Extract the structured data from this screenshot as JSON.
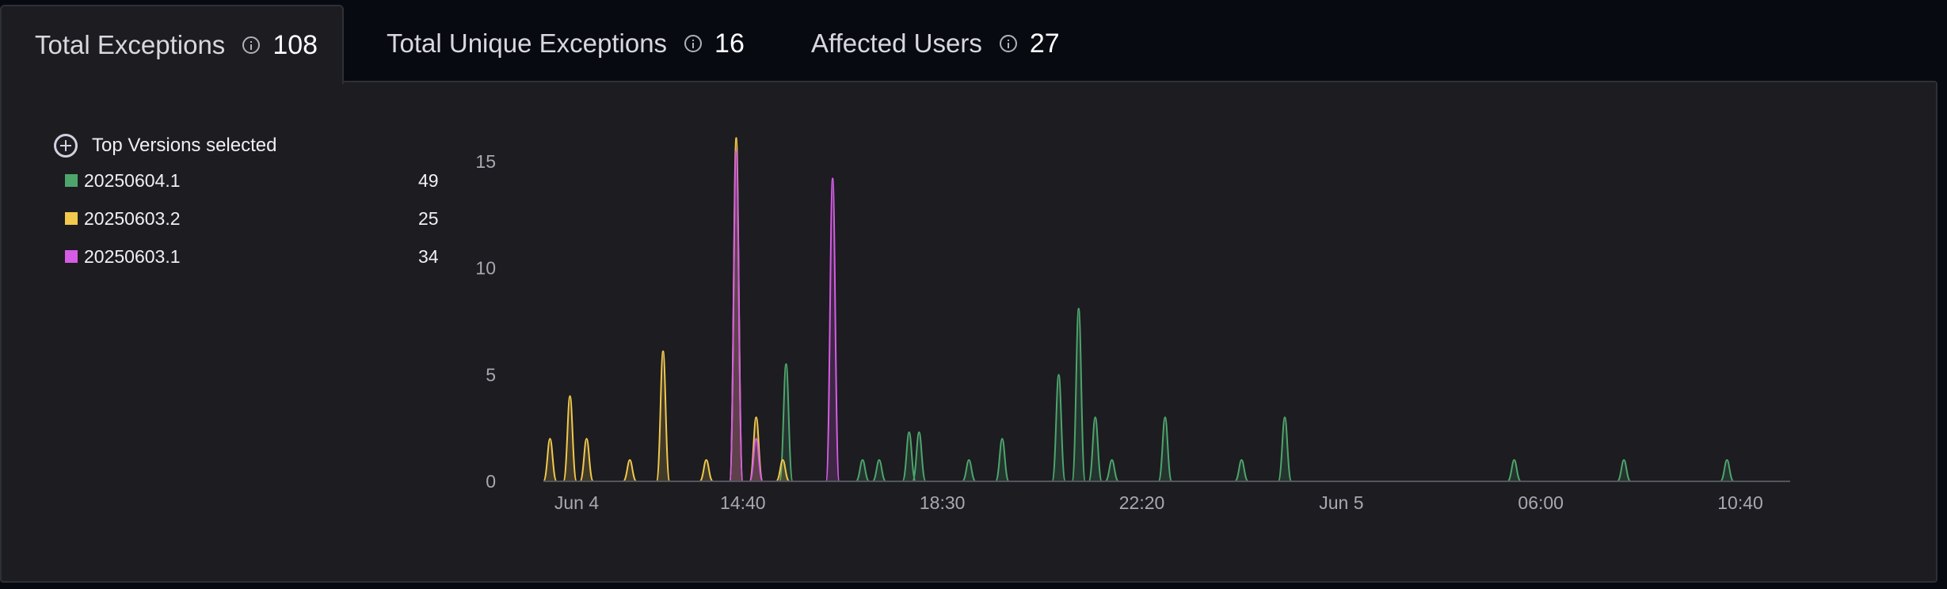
{
  "tabs": [
    {
      "label": "Total Exceptions",
      "value": "108",
      "active": true
    },
    {
      "label": "Total Unique Exceptions",
      "value": "16",
      "active": false
    },
    {
      "label": "Affected Users",
      "value": "27",
      "active": false
    }
  ],
  "legend": {
    "heading": "Top Versions selected",
    "items": [
      {
        "name": "20250604.1",
        "count": "49",
        "color": "#4ea56c"
      },
      {
        "name": "20250603.2",
        "count": "25",
        "color": "#f2c94c"
      },
      {
        "name": "20250603.1",
        "count": "34",
        "color": "#d65ce6"
      }
    ]
  },
  "chart_data": {
    "type": "area",
    "x_unit": "hours after Jun 4 00:00",
    "ylim": [
      0,
      17
    ],
    "xlim": [
      0,
      37.5
    ],
    "yticks": [
      0,
      5,
      10,
      15
    ],
    "ytick_labels": [
      "0",
      "5",
      "10",
      "15"
    ],
    "xticks": [
      0,
      6,
      12,
      18,
      24,
      30,
      36
    ],
    "xtick_labels": [
      "Jun 4",
      "14:40",
      "18:30",
      "22:20",
      "Jun 5",
      "06:00",
      "10:40"
    ],
    "grid": false,
    "series": [
      {
        "name": "20250604.1",
        "color": "#4ea56c",
        "points": [
          [
            7.3,
            5.5
          ],
          [
            9.6,
            1
          ],
          [
            10.1,
            1
          ],
          [
            11.0,
            2.3
          ],
          [
            11.3,
            2.3
          ],
          [
            12.8,
            1
          ],
          [
            13.8,
            2
          ],
          [
            15.5,
            5
          ],
          [
            16.1,
            8.1
          ],
          [
            16.6,
            3
          ],
          [
            17.1,
            1
          ],
          [
            18.7,
            3
          ],
          [
            21.0,
            1
          ],
          [
            22.3,
            3
          ],
          [
            29.2,
            1
          ],
          [
            32.5,
            1
          ],
          [
            35.6,
            1
          ]
        ]
      },
      {
        "name": "20250603.2",
        "color": "#f2c94c",
        "points": [
          [
            0.2,
            2
          ],
          [
            0.8,
            4
          ],
          [
            1.3,
            2
          ],
          [
            2.6,
            1
          ],
          [
            3.6,
            6.1
          ],
          [
            4.9,
            1
          ],
          [
            5.8,
            16.1
          ],
          [
            6.4,
            3
          ],
          [
            7.2,
            1
          ]
        ]
      },
      {
        "name": "20250603.1",
        "color": "#d65ce6",
        "points": [
          [
            5.8,
            15.5
          ],
          [
            6.4,
            2
          ],
          [
            8.7,
            14.2
          ]
        ]
      }
    ]
  }
}
